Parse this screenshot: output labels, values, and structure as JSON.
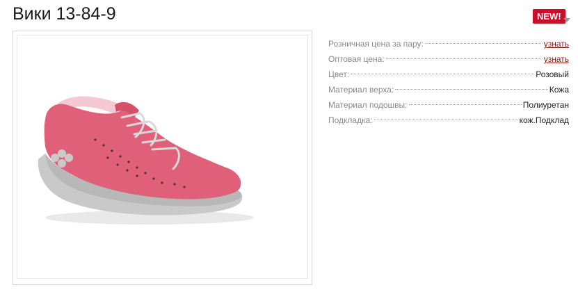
{
  "product": {
    "title": "Вики 13-84-9",
    "badge": "NEW!"
  },
  "colors": {
    "badge": "#c8102e",
    "link": "#8b1a1a",
    "shoe_upper": "#e0607a",
    "shoe_sole": "#c9c9c9"
  },
  "icons": {
    "product_image": "pink-sneaker-image"
  },
  "specs": [
    {
      "label": "Розничная цена за пару:",
      "value": "узнать",
      "is_link": true
    },
    {
      "label": "Оптовая цена:",
      "value": "узнать",
      "is_link": true
    },
    {
      "label": "Цвет:",
      "value": "Розовый",
      "is_link": false
    },
    {
      "label": "Материал верха:",
      "value": "Кожа",
      "is_link": false
    },
    {
      "label": "Материал подошвы:",
      "value": "Полиуретан",
      "is_link": false
    },
    {
      "label": "Подкладка:",
      "value": "кож.Подклад",
      "is_link": false
    }
  ]
}
